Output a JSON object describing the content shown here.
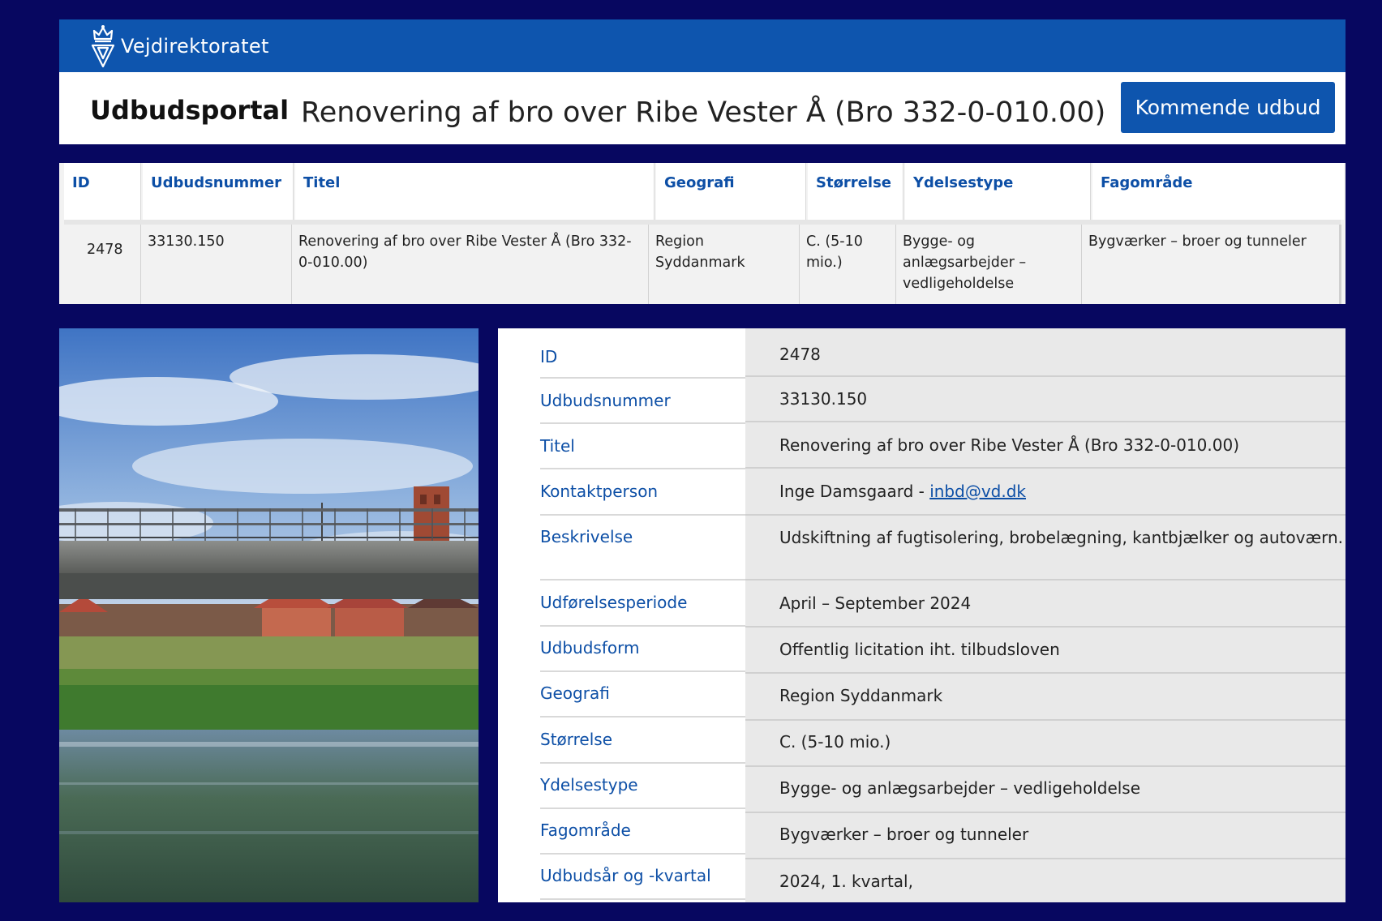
{
  "brand": {
    "name": "Vejdirektoratet"
  },
  "header": {
    "portal_title": "Udbudsportal",
    "page_title": "Renovering af bro over Ribe Vester Å (Bro 332-0-010.00)",
    "cta_label": "Kommende udbud"
  },
  "result_table": {
    "columns": [
      "ID",
      "Udbudsnummer",
      "Titel",
      "Geografi",
      "Størrelse",
      "Ydelsestype",
      "Fagområde"
    ],
    "row": {
      "id": "2478",
      "udbudsnummer": "33130.150",
      "titel": "Renovering af bro over Ribe Vester Å (Bro 332-0-010.00)",
      "geografi": "Region Syddanmark",
      "stoerrelse": "C. (5-10 mio.)",
      "ydelsestype": "Bygge- og anlægsarbejder – vedligeholdelse",
      "fagomraade": "Bygværker – broer og tunneler"
    }
  },
  "details": [
    {
      "label": "ID",
      "value": "2478"
    },
    {
      "label": "Udbudsnummer",
      "value": "33130.150"
    },
    {
      "label": "Titel",
      "value": "Renovering af bro over Ribe Vester Å (Bro 332-0-010.00)"
    },
    {
      "label": "Kontaktperson",
      "value": "Inge Damsgaard - ",
      "email": "inbd@vd.dk"
    },
    {
      "label": "Beskrivelse",
      "value": "Udskiftning af fugtisolering, brobelægning, kantbjælker og autoværn."
    },
    {
      "label": "Udførelsesperiode",
      "value": "April – September 2024"
    },
    {
      "label": "Udbudsform",
      "value": "Offentlig licitation iht. tilbudsloven"
    },
    {
      "label": "Geografi",
      "value": "Region Syddanmark"
    },
    {
      "label": "Størrelse",
      "value": "C. (5-10 mio.)"
    },
    {
      "label": "Ydelsestype",
      "value": "Bygge- og anlægsarbejder – vedligeholdelse"
    },
    {
      "label": "Fagområde",
      "value": "Bygværker – broer og tunneler"
    },
    {
      "label": "Udbudsår og -kvartal",
      "value": "2024, 1. kvartal,"
    }
  ],
  "colors": {
    "background": "#070760",
    "brand_blue": "#0e55ae",
    "link_blue": "#0d4fa6"
  },
  "icons": {
    "logo": "crown-shield-logo-icon"
  }
}
